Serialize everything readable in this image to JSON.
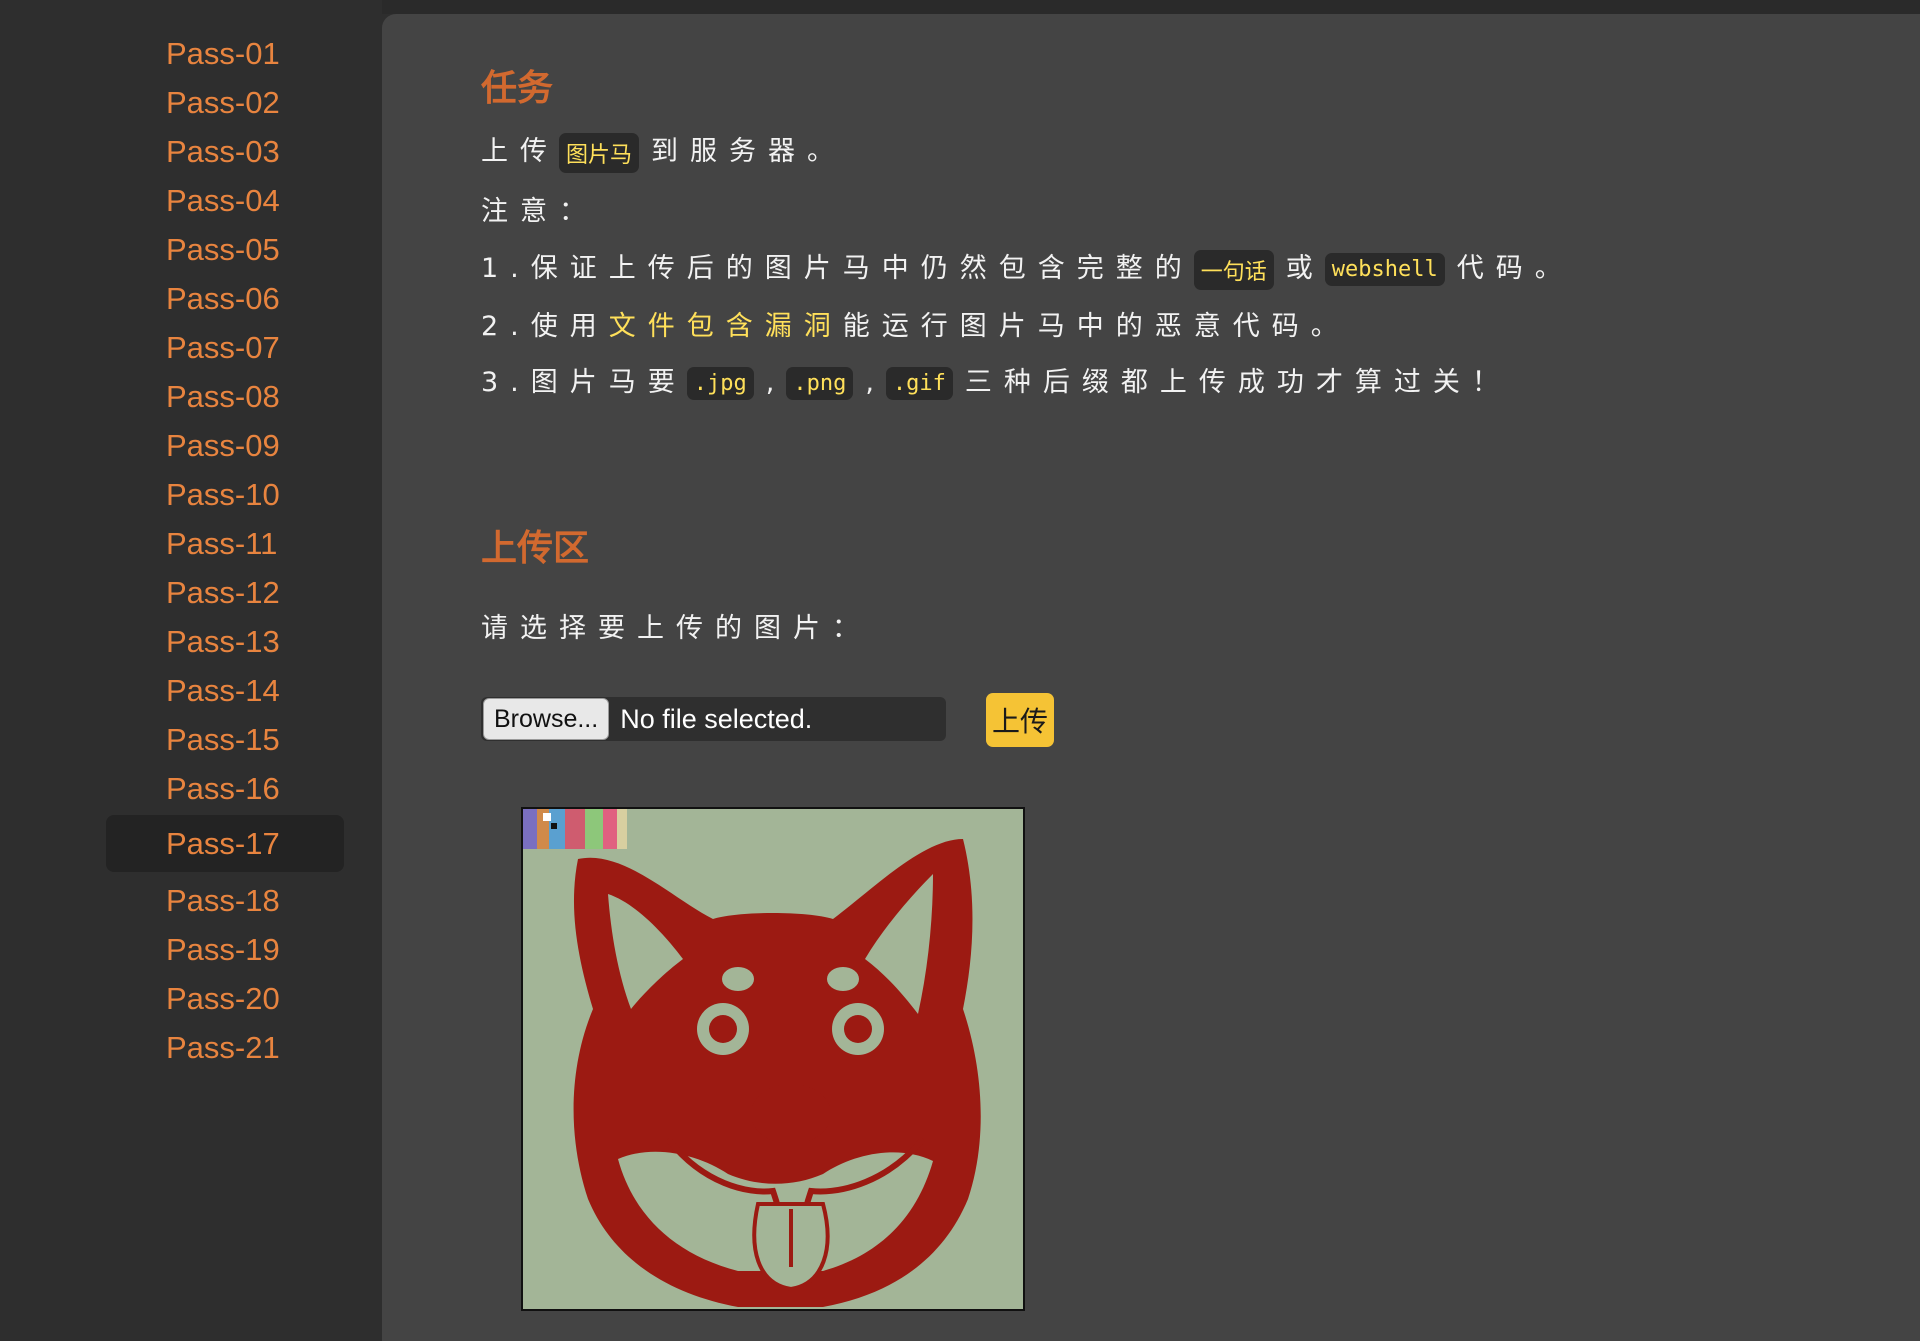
{
  "sidebar": {
    "items": [
      "Pass-01",
      "Pass-02",
      "Pass-03",
      "Pass-04",
      "Pass-05",
      "Pass-06",
      "Pass-07",
      "Pass-08",
      "Pass-09",
      "Pass-10",
      "Pass-11",
      "Pass-12",
      "Pass-13",
      "Pass-14",
      "Pass-15",
      "Pass-16",
      "Pass-17",
      "Pass-18",
      "Pass-19",
      "Pass-20",
      "Pass-21"
    ],
    "active": "Pass-17"
  },
  "task": {
    "title": "任务",
    "line1": {
      "pre": "上传",
      "code": "图片马",
      "post": "到服务器。"
    },
    "note": "注意：",
    "point1": {
      "pre": "1.保证上传后的图片马中仍然包含完整的",
      "code1": "一句话",
      "mid": "或",
      "code2": "webshell",
      "post": "代码。"
    },
    "point2": {
      "pre": "2.使用",
      "highlight": "文件包含漏洞",
      "post": "能运行图片马中的恶意代码。"
    },
    "point3": {
      "pre": "3.图片马要",
      "code1": ".jpg",
      "sep1": ",",
      "code2": ".png",
      "sep2": ",",
      "code3": ".gif",
      "post": "三种后缀都上传成功才算过关！"
    }
  },
  "upload": {
    "title": "上传区",
    "prompt": "请选择要上传的图片：",
    "browse_label": "Browse...",
    "file_status": "No file selected.",
    "submit_label": "上传"
  },
  "colors": {
    "accent_orange": "#e8843f",
    "heading_orange": "#d2692f",
    "code_yellow": "#ffe05a",
    "button_yellow": "#f5c335",
    "dog_red": "#9c1a12",
    "image_background": "#a3b597"
  },
  "preview_image": {
    "subject": "red-dog-face-icon"
  }
}
